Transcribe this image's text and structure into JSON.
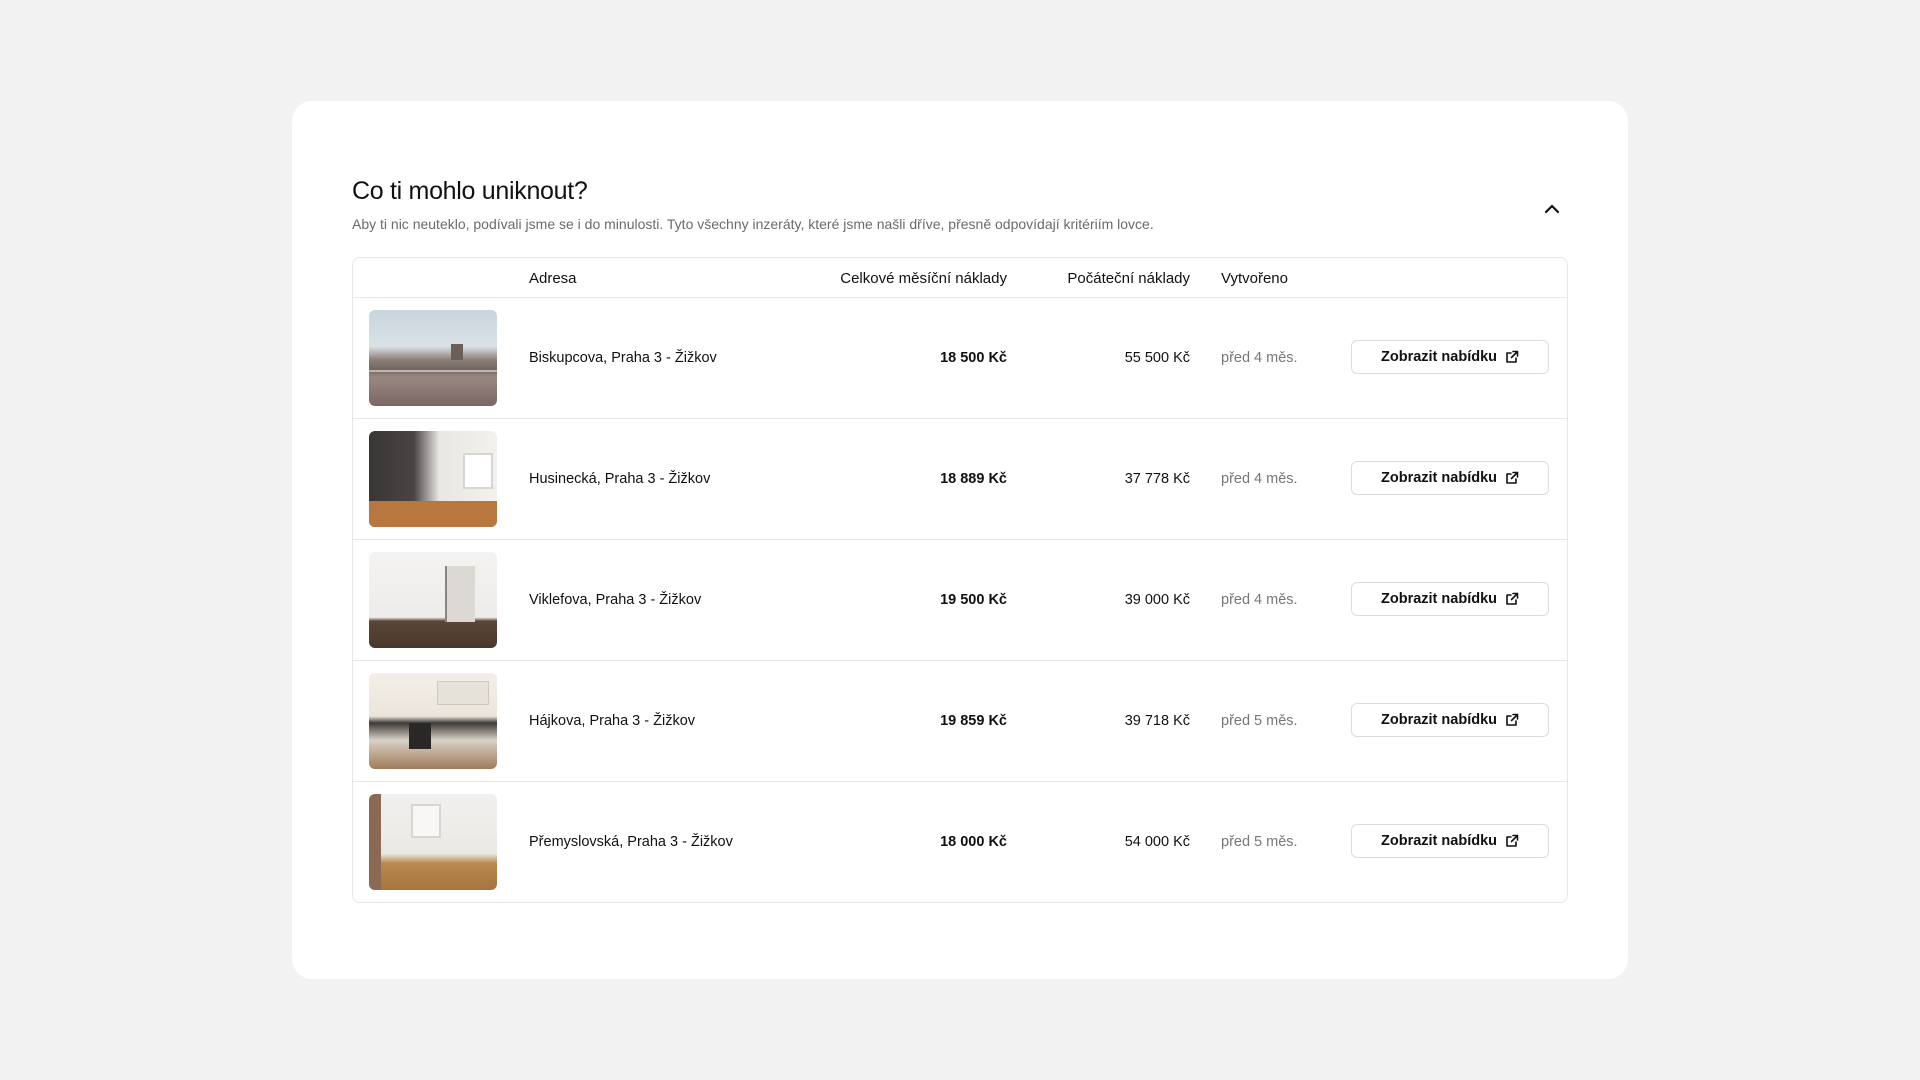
{
  "section": {
    "title": "Co ti mohlo uniknout?",
    "subtitle": "Aby ti nic neuteklo, podívali jsme se i do minulosti. Tyto všechny inzeráty, které jsme našli dříve, přesně odpovídají kritériím lovce.",
    "collapse_icon": "chevron-up-icon"
  },
  "table": {
    "headers": {
      "address": "Adresa",
      "monthly": "Celkové měsíční náklady",
      "initial": "Počáteční náklady",
      "created": "Vytvořeno"
    },
    "rows": [
      {
        "address": "Biskupcova, Praha 3 - Žižkov",
        "monthly": "18 500 Kč",
        "initial": "55 500 Kč",
        "created": "před 4 měs.",
        "button": "Zobrazit nabídku"
      },
      {
        "address": "Husinecká, Praha 3 - Žižkov",
        "monthly": "18 889 Kč",
        "initial": "37 778 Kč",
        "created": "před 4 měs.",
        "button": "Zobrazit nabídku"
      },
      {
        "address": "Viklefova, Praha 3 - Žižkov",
        "monthly": "19 500 Kč",
        "initial": "39 000 Kč",
        "created": "před 4 měs.",
        "button": "Zobrazit nabídku"
      },
      {
        "address": "Hájkova, Praha 3 - Žižkov",
        "monthly": "19 859 Kč",
        "initial": "39 718 Kč",
        "created": "před 5 měs.",
        "button": "Zobrazit nabídku"
      },
      {
        "address": "Přemyslovská, Praha 3 - Žižkov",
        "monthly": "18 000 Kč",
        "initial": "54 000 Kč",
        "created": "před 5 měs.",
        "button": "Zobrazit nabídku"
      }
    ]
  },
  "icons": {
    "external_link": "external-link-icon"
  },
  "colors": {
    "page_background": "#f2f2f2",
    "card_background": "#ffffff",
    "border": "#e6e6e6",
    "muted_text": "#6b6b6b"
  }
}
